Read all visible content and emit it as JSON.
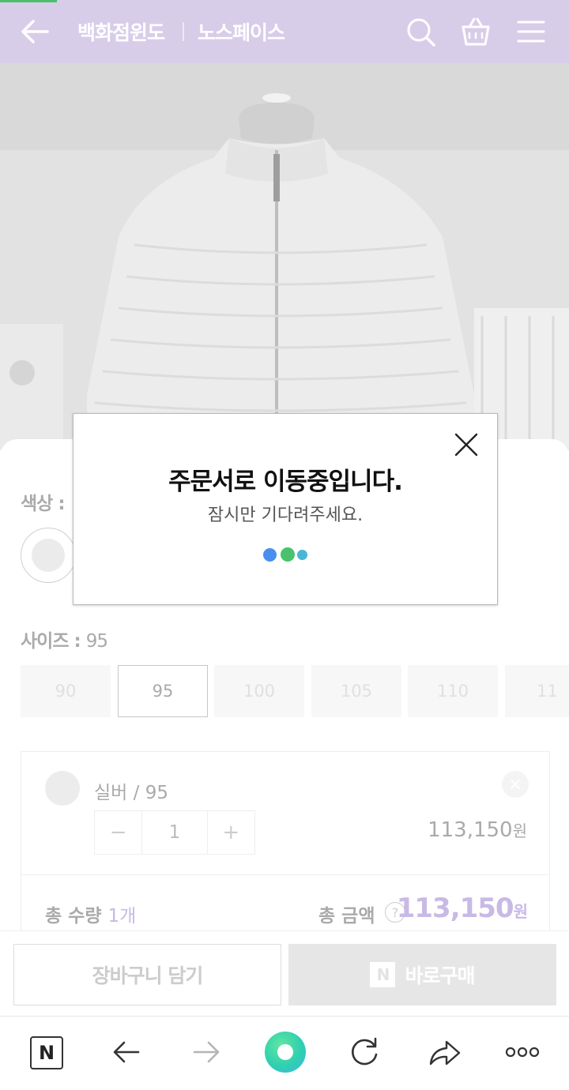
{
  "header": {
    "store_name": "백화점윈도",
    "brand_name": "노스페이스",
    "icons": [
      "back-arrow-icon",
      "search-icon",
      "shopping-bag-icon",
      "menu-icon"
    ],
    "background_color": "#d8cde9"
  },
  "options": {
    "color_label": "색상 :",
    "size_label": "사이즈 :",
    "size_selected": "95",
    "sizes": [
      "90",
      "95",
      "100",
      "105",
      "110",
      "11"
    ]
  },
  "selection": {
    "item_name": "실버 / 95",
    "quantity": "1",
    "minus": "−",
    "plus": "+",
    "price": "113,150",
    "currency": "원",
    "total_qty_label": "총 수량",
    "total_qty_value": "1개",
    "total_amount_label": "총 금액",
    "help": "?",
    "total_price": "113,150",
    "accent_color": "#c8b9e6"
  },
  "actions": {
    "add_to_cart": "장바구니 담기",
    "buy_now": "바로구매",
    "npay_mark": "N"
  },
  "browser_bar": {
    "home_mark": "N",
    "icons": [
      "naver-home-icon",
      "back-icon",
      "forward-icon",
      "green-dot-icon",
      "refresh-icon",
      "share-icon",
      "more-icon"
    ]
  },
  "modal": {
    "title": "주문서로 이동중입니다.",
    "subtitle": "잠시만 기다려주세요.",
    "loader_colors": [
      "#4a8ff0",
      "#49c26c",
      "#49b6d6"
    ]
  }
}
